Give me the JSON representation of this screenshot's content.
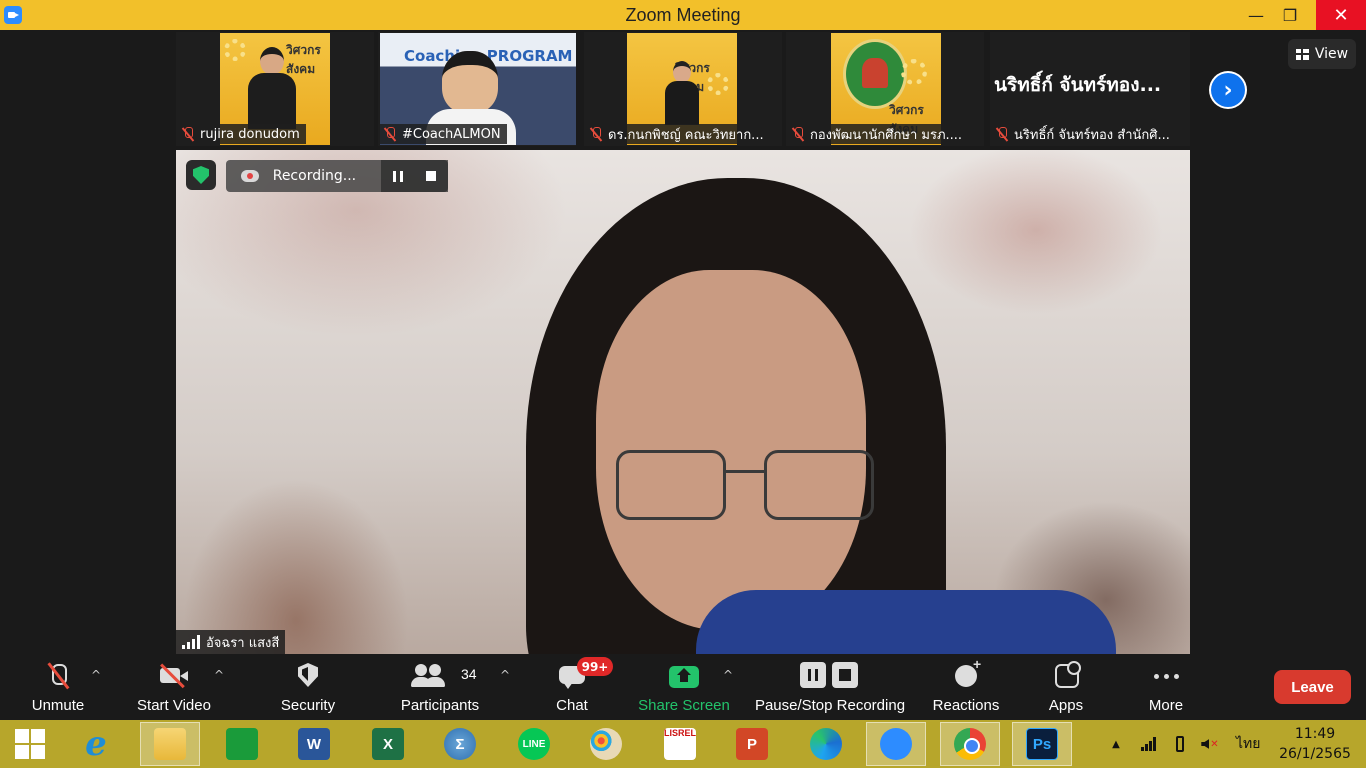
{
  "window": {
    "title": "Zoom Meeting",
    "minimize_symbol": "—",
    "maximize_symbol": "❐",
    "close_symbol": "✕"
  },
  "gallery": {
    "participants": [
      {
        "name": "rujira donudom",
        "muted": true
      },
      {
        "name": "#CoachALMON",
        "muted": true,
        "poster_text": "Coaching PROGRAM"
      },
      {
        "name": "ดร.กนกพิชญ์ คณะวิทยาก...",
        "muted": true
      },
      {
        "name": "กองพัฒนานักศึกษา มรภ....",
        "muted": true
      },
      {
        "name": "นริทธิ์ก์ จันทร์ทอง สำนักศิ...",
        "muted": true,
        "tile_text": "นริทธิ์ก์ จันทร์ทอง..."
      }
    ],
    "poster_brand": "วิศวกรสังคม",
    "next_icon": "chevron-right-icon",
    "next_symbol": "›",
    "view_label": "View"
  },
  "main_video": {
    "speaker_name": "อัจฉรา แสงสี",
    "recording_label": "Recording...",
    "encryption_icon": "shield-check-icon"
  },
  "toolbar": {
    "items": [
      {
        "label": "Unmute",
        "icon": "mic-off-icon"
      },
      {
        "label": "Start Video",
        "icon": "video-off-icon"
      },
      {
        "label": "Security",
        "icon": "shield-icon"
      },
      {
        "label": "Participants",
        "icon": "participants-icon",
        "count": "34"
      },
      {
        "label": "Chat",
        "icon": "chat-icon",
        "badge": "99+"
      },
      {
        "label": "Share Screen",
        "icon": "share-screen-icon"
      },
      {
        "label": "Pause/Stop Recording",
        "icon": "pause-stop-icon"
      },
      {
        "label": "Reactions",
        "icon": "reactions-icon"
      },
      {
        "label": "Apps",
        "icon": "apps-icon"
      },
      {
        "label": "More",
        "icon": "more-icon"
      }
    ],
    "caret_symbol": "^",
    "leave_label": "Leave",
    "share_color": "#23c36b",
    "leave_color": "#d83a2e"
  },
  "taskbar": {
    "apps": [
      {
        "name": "start",
        "icon": "windows-logo-icon"
      },
      {
        "name": "internet-explorer",
        "icon": "ie-icon",
        "glyph": "e"
      },
      {
        "name": "file-explorer",
        "icon": "folder-icon"
      },
      {
        "name": "store",
        "icon": "store-icon"
      },
      {
        "name": "word",
        "icon": "word-icon",
        "glyph": "W"
      },
      {
        "name": "excel",
        "icon": "excel-icon",
        "glyph": "X"
      },
      {
        "name": "math",
        "icon": "sigma-icon",
        "glyph": "Σ"
      },
      {
        "name": "line",
        "icon": "line-icon",
        "glyph": "LINE"
      },
      {
        "name": "paint",
        "icon": "paint-icon"
      },
      {
        "name": "lisrel",
        "icon": "lisrel-icon",
        "glyph": "LISREL"
      },
      {
        "name": "powerpoint",
        "icon": "powerpoint-icon",
        "glyph": "P"
      },
      {
        "name": "edge",
        "icon": "edge-icon"
      },
      {
        "name": "zoom",
        "icon": "zoom-icon"
      },
      {
        "name": "chrome",
        "icon": "chrome-icon"
      },
      {
        "name": "photoshop",
        "icon": "photoshop-icon",
        "glyph": "Ps"
      }
    ],
    "language": "ไทย",
    "time": "11:49",
    "date": "26/1/2565",
    "tray_up_symbol": "▲",
    "color": "#b7a62b"
  }
}
